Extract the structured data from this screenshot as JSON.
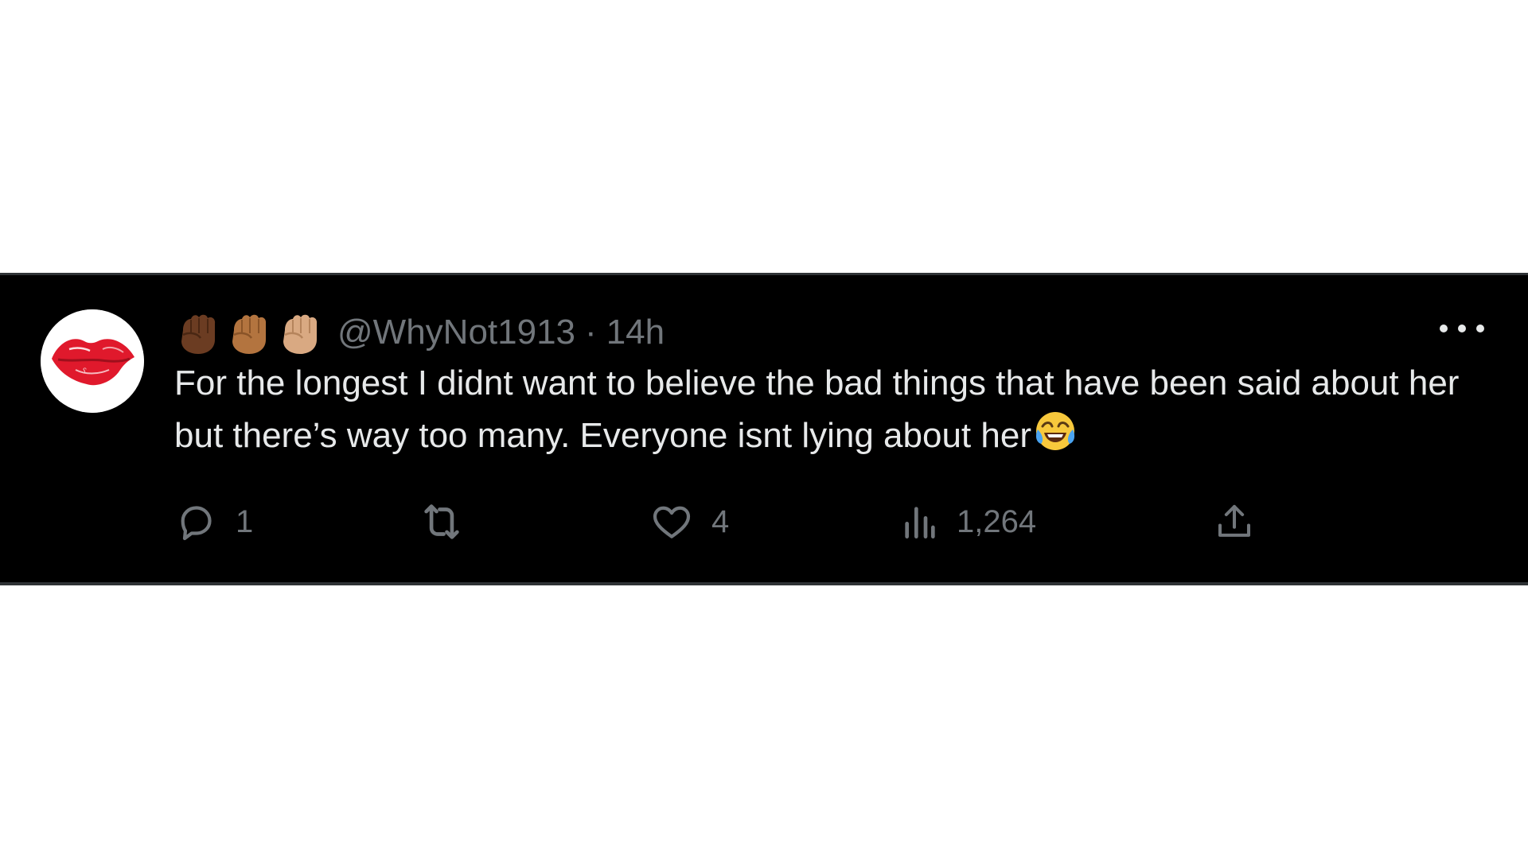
{
  "tweet": {
    "author": {
      "handle": "@WhyNot1913",
      "name_emojis": [
        "raised-fist-dark-skin",
        "raised-fist-medium-skin",
        "raised-fist-light-skin"
      ],
      "avatar": "red-lips-icon"
    },
    "separator": "·",
    "time": "14h",
    "text": "For the longest I didnt want to believe the bad things that have been said about her but there’s way too many. Everyone isnt lying about her",
    "trailing_emoji": "face-with-tears-of-joy",
    "more_icon": "more-horizontal-icon",
    "actions": {
      "reply": {
        "icon": "reply-icon",
        "count": "1"
      },
      "retweet": {
        "icon": "retweet-icon",
        "count": ""
      },
      "like": {
        "icon": "heart-icon",
        "count": "4"
      },
      "views": {
        "icon": "views-icon",
        "count": "1,264"
      },
      "share": {
        "icon": "share-icon"
      }
    }
  },
  "colors": {
    "card_background": "#000000",
    "primary_text": "#e7e9ea",
    "secondary_text": "#71767b",
    "border": "#2f3336",
    "avatar_accent": "#e0192c"
  }
}
